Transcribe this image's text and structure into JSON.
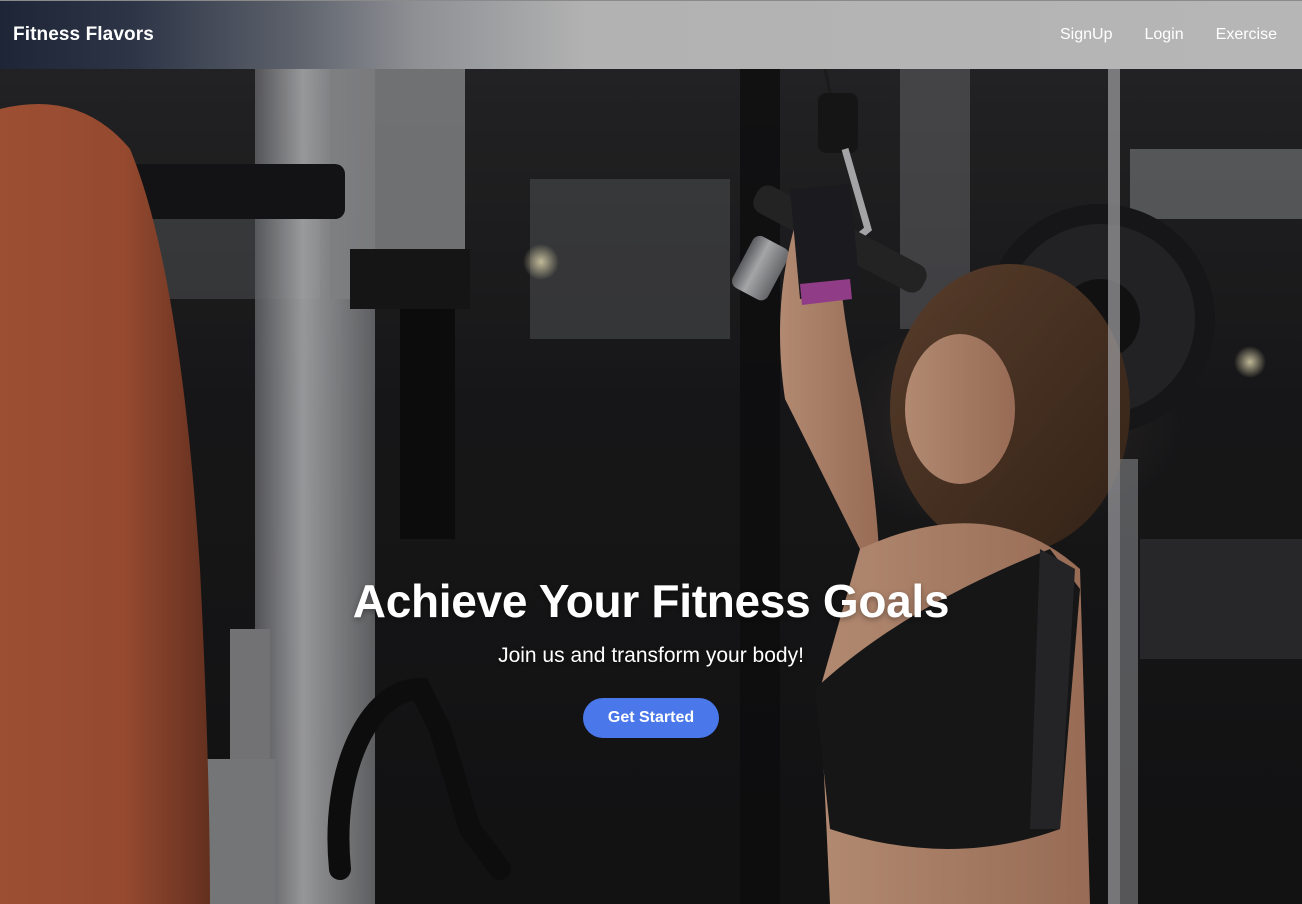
{
  "nav": {
    "brand": "Fitness Flavors",
    "links": [
      {
        "label": "SignUp"
      },
      {
        "label": "Login"
      },
      {
        "label": "Exercise"
      }
    ]
  },
  "hero": {
    "title": "Achieve Your Fitness Goals",
    "subtitle": "Join us and transform your body!",
    "cta_label": "Get Started"
  },
  "colors": {
    "navbar_start": "#1d2537",
    "navbar_end": "#b6b6b6",
    "cta": "#4a78ea",
    "text": "#ffffff"
  }
}
